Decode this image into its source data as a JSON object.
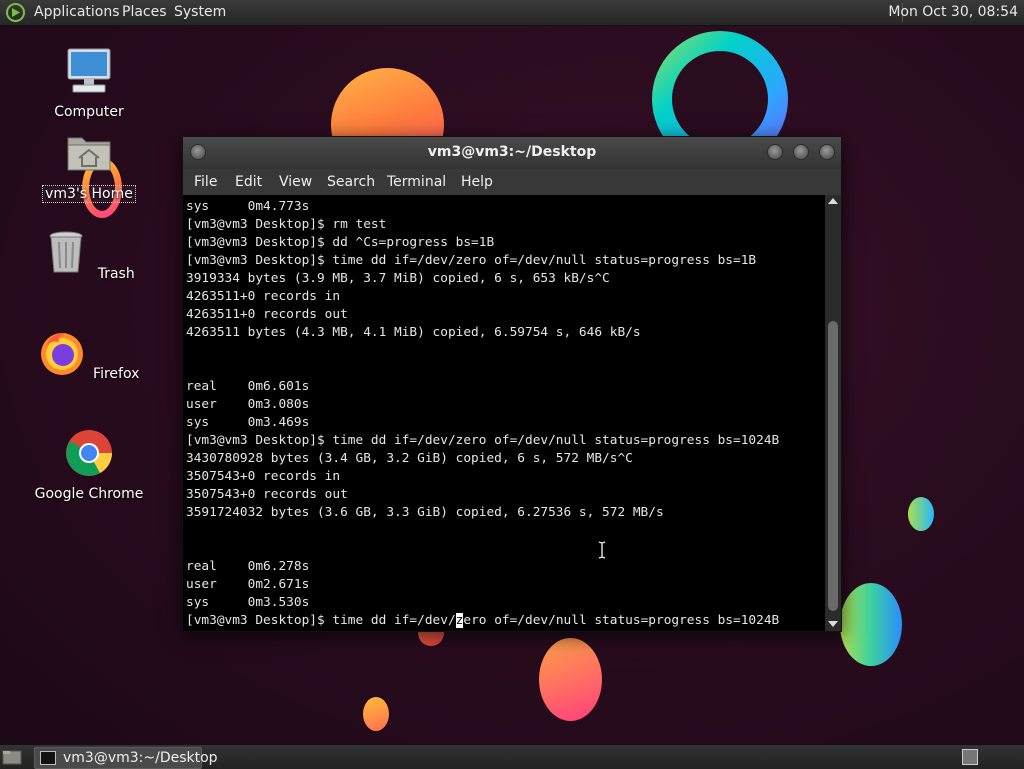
{
  "top_panel": {
    "menus": [
      "Applications",
      "Places",
      "System"
    ],
    "clock": "Mon Oct 30, 08:54"
  },
  "desktop_icons": [
    {
      "label": "Computer",
      "icon": "computer-icon"
    },
    {
      "label": "vm3's Home",
      "icon": "home-folder-icon"
    },
    {
      "label": "Trash",
      "icon": "trash-icon"
    },
    {
      "label": "Firefox",
      "icon": "firefox-icon"
    },
    {
      "label": "Google Chrome",
      "icon": "chrome-icon"
    }
  ],
  "terminal": {
    "title": "vm3@vm3:~/Desktop",
    "menu": [
      "File",
      "Edit",
      "View",
      "Search",
      "Terminal",
      "Help"
    ],
    "lines": [
      "sys     0m4.773s",
      "[vm3@vm3 Desktop]$ rm test",
      "[vm3@vm3 Desktop]$ dd ^Cs=progress bs=1B",
      "[vm3@vm3 Desktop]$ time dd if=/dev/zero of=/dev/null status=progress bs=1B",
      "3919334 bytes (3.9 MB, 3.7 MiB) copied, 6 s, 653 kB/s^C",
      "4263511+0 records in",
      "4263511+0 records out",
      "4263511 bytes (4.3 MB, 4.1 MiB) copied, 6.59754 s, 646 kB/s",
      "",
      "",
      "real    0m6.601s",
      "user    0m3.080s",
      "sys     0m3.469s",
      "[vm3@vm3 Desktop]$ time dd if=/dev/zero of=/dev/null status=progress bs=1024B",
      "3430780928 bytes (3.4 GB, 3.2 GiB) copied, 6 s, 572 MB/s^C",
      "3507543+0 records in",
      "3507543+0 records out",
      "3591724032 bytes (3.6 GB, 3.3 GiB) copied, 6.27536 s, 572 MB/s",
      "",
      "",
      "real    0m6.278s",
      "user    0m2.671s",
      "sys     0m3.530s"
    ],
    "prompt_before_cursor": "[vm3@vm3 Desktop]$ time dd if=/dev/",
    "cursor_char": "z",
    "prompt_after_cursor": "ero of=/dev/null status=progress bs=1024B"
  },
  "taskbar": {
    "task_label": "vm3@vm3:~/Desktop"
  }
}
